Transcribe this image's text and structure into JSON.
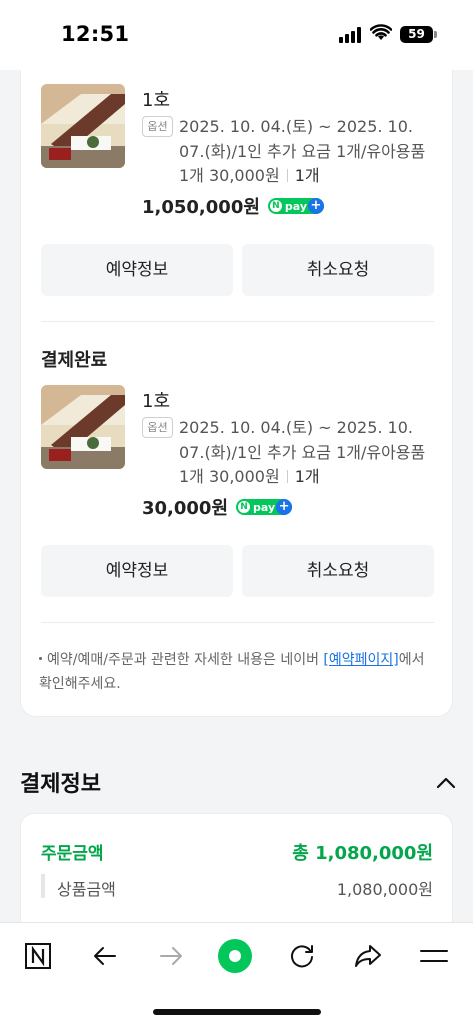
{
  "status_bar": {
    "time": "12:51",
    "battery": "59"
  },
  "order_items": [
    {
      "name": "1호",
      "option_badge": "옵션",
      "option_text": "2025. 10. 04.(토) ~ 2025. 10. 07.(화)/1인 추가 요금 1개/유아용품 1개 30,000원",
      "quantity": "1개",
      "price": "1,050,000원",
      "pay_badge": "pay",
      "buttons": {
        "info": "예약정보",
        "cancel": "취소요청"
      }
    },
    {
      "status": "결제완료",
      "name": "1호",
      "option_badge": "옵션",
      "option_text": "2025. 10. 04.(토) ~ 2025. 10. 07.(화)/1인 추가 요금 1개/유아용품 1개 30,000원",
      "quantity": "1개",
      "price": "30,000원",
      "pay_badge": "pay",
      "buttons": {
        "info": "예약정보",
        "cancel": "취소요청"
      }
    }
  ],
  "notice": {
    "text_before": "예약/예매/주문과 관련한 자세한 내용은 네이버 ",
    "link": "[예약페이지]",
    "text_after": "에서 확인해주세요."
  },
  "payment": {
    "title": "결제정보",
    "order_amount_label": "주문금액",
    "order_amount_value": "총 1,080,000원",
    "product_amount_label": "상품금액",
    "product_amount_value": "1,080,000원"
  },
  "toolbar": {
    "items": [
      "naver-home-icon",
      "back-arrow-icon",
      "forward-arrow-icon",
      "green-dot-icon",
      "refresh-icon",
      "share-icon",
      "menu-icon"
    ]
  },
  "colors": {
    "accent_green": "#03c75a",
    "price_green": "#03a64a",
    "link_blue": "#1a73e8"
  }
}
